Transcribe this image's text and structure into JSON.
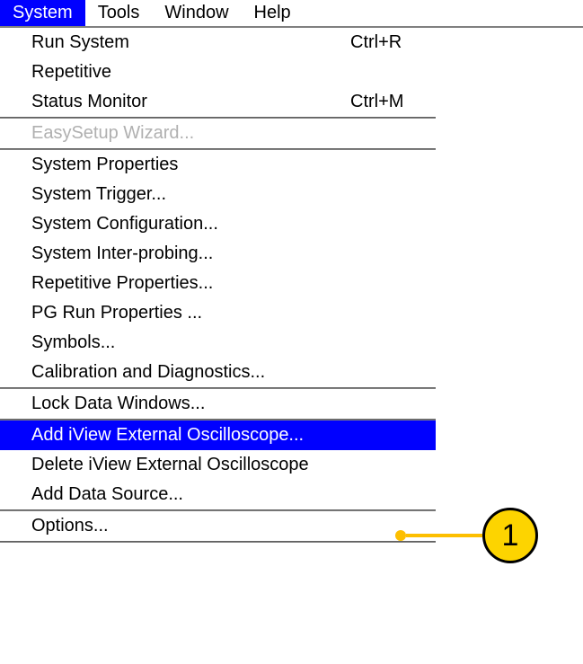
{
  "menubar": {
    "items": [
      {
        "label": "System",
        "active": true
      },
      {
        "label": "Tools",
        "active": false
      },
      {
        "label": "Window",
        "active": false
      },
      {
        "label": "Help",
        "active": false
      }
    ]
  },
  "menu": {
    "groups": [
      {
        "items": [
          {
            "label": "Run System",
            "shortcut": "Ctrl+R",
            "disabled": false,
            "highlight": false
          },
          {
            "label": "Repetitive",
            "shortcut": "",
            "disabled": false,
            "highlight": false
          },
          {
            "label": "Status Monitor",
            "shortcut": "Ctrl+M",
            "disabled": false,
            "highlight": false
          }
        ]
      },
      {
        "items": [
          {
            "label": "EasySetup Wizard...",
            "shortcut": "",
            "disabled": true,
            "highlight": false
          }
        ]
      },
      {
        "items": [
          {
            "label": "System Properties",
            "shortcut": "",
            "disabled": false,
            "highlight": false
          },
          {
            "label": "System Trigger...",
            "shortcut": "",
            "disabled": false,
            "highlight": false
          },
          {
            "label": "System Configuration...",
            "shortcut": "",
            "disabled": false,
            "highlight": false
          },
          {
            "label": "System Inter-probing...",
            "shortcut": "",
            "disabled": false,
            "highlight": false
          },
          {
            "label": "Repetitive Properties...",
            "shortcut": "",
            "disabled": false,
            "highlight": false
          },
          {
            "label": "PG Run Properties ...",
            "shortcut": "",
            "disabled": false,
            "highlight": false
          },
          {
            "label": "Symbols...",
            "shortcut": "",
            "disabled": false,
            "highlight": false
          },
          {
            "label": "Calibration and Diagnostics...",
            "shortcut": "",
            "disabled": false,
            "highlight": false
          }
        ]
      },
      {
        "items": [
          {
            "label": "Lock Data Windows...",
            "shortcut": "",
            "disabled": false,
            "highlight": false
          }
        ]
      },
      {
        "items": [
          {
            "label": "Add iView External Oscilloscope...",
            "shortcut": "",
            "disabled": false,
            "highlight": true
          },
          {
            "label": "Delete iView External Oscilloscope",
            "shortcut": "",
            "disabled": false,
            "highlight": false
          },
          {
            "label": "Add Data Source...",
            "shortcut": "",
            "disabled": false,
            "highlight": false
          }
        ]
      },
      {
        "items": [
          {
            "label": "Options...",
            "shortcut": "",
            "disabled": false,
            "highlight": false
          }
        ]
      }
    ]
  },
  "annotation": {
    "number": "1"
  }
}
